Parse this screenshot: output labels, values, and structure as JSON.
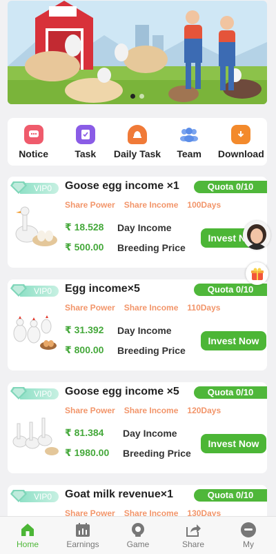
{
  "banner": {
    "slides": 2,
    "active_index": 0
  },
  "menu": [
    {
      "label": "Notice",
      "icon": "notice-icon",
      "color": "#ef5b6c"
    },
    {
      "label": "Task",
      "icon": "task-icon",
      "color": "#8a5ce6"
    },
    {
      "label": "Daily Task",
      "icon": "daily-task-icon",
      "color": "#f07a38"
    },
    {
      "label": "Team",
      "icon": "team-icon",
      "color": "#5b8de8"
    },
    {
      "label": "Download",
      "icon": "download-icon",
      "color": "#f38a2c"
    }
  ],
  "products": [
    {
      "vip": "VIP0",
      "title": "Goose egg income ×1",
      "quota": "Quota 0/10",
      "tag1": "Share Power",
      "tag2": "Share Income",
      "days": "100Days",
      "day_income": "₹ 18.528",
      "day_income_label": "Day Income",
      "price": "₹ 500.00",
      "price_label": "Breeding Price",
      "button": "Invest Now",
      "image": "goose-egg-image"
    },
    {
      "vip": "VIP0",
      "title": "Egg income×5",
      "quota": "Quota 0/10",
      "tag1": "Share Power",
      "tag2": "Share Income",
      "days": "110Days",
      "day_income": "₹ 31.392",
      "day_income_label": "Day Income",
      "price": "₹ 800.00",
      "price_label": "Breeding Price",
      "button": "Invest Now",
      "image": "chicken-egg-image"
    },
    {
      "vip": "VIP0",
      "title": "Goose egg income ×5",
      "quota": "Quota 0/10",
      "tag1": "Share Power",
      "tag2": "Share Income",
      "days": "120Days",
      "day_income": "₹ 81.384",
      "day_income_label": "Day Income",
      "price": "₹ 1980.00",
      "price_label": "Breeding Price",
      "button": "Invest Now",
      "image": "geese-image"
    },
    {
      "vip": "VIP0",
      "title": "Goat milk revenue×1",
      "quota": "Quota 0/10",
      "tag1": "Share Power",
      "tag2": "Share Income",
      "days": "130Days",
      "day_income": "",
      "day_income_label": "",
      "price": "",
      "price_label": "",
      "button": "",
      "image": "goat-image"
    }
  ],
  "nav": [
    {
      "label": "Home",
      "icon": "home-icon",
      "active": true
    },
    {
      "label": "Earnings",
      "icon": "earnings-icon",
      "active": false
    },
    {
      "label": "Game",
      "icon": "game-icon",
      "active": false
    },
    {
      "label": "Share",
      "icon": "share-icon",
      "active": false
    },
    {
      "label": "My",
      "icon": "my-icon",
      "active": false
    }
  ],
  "colors": {
    "accent": "#4cb636",
    "tag_orange": "#f2956a",
    "vip_green": "#8fe0c6"
  }
}
